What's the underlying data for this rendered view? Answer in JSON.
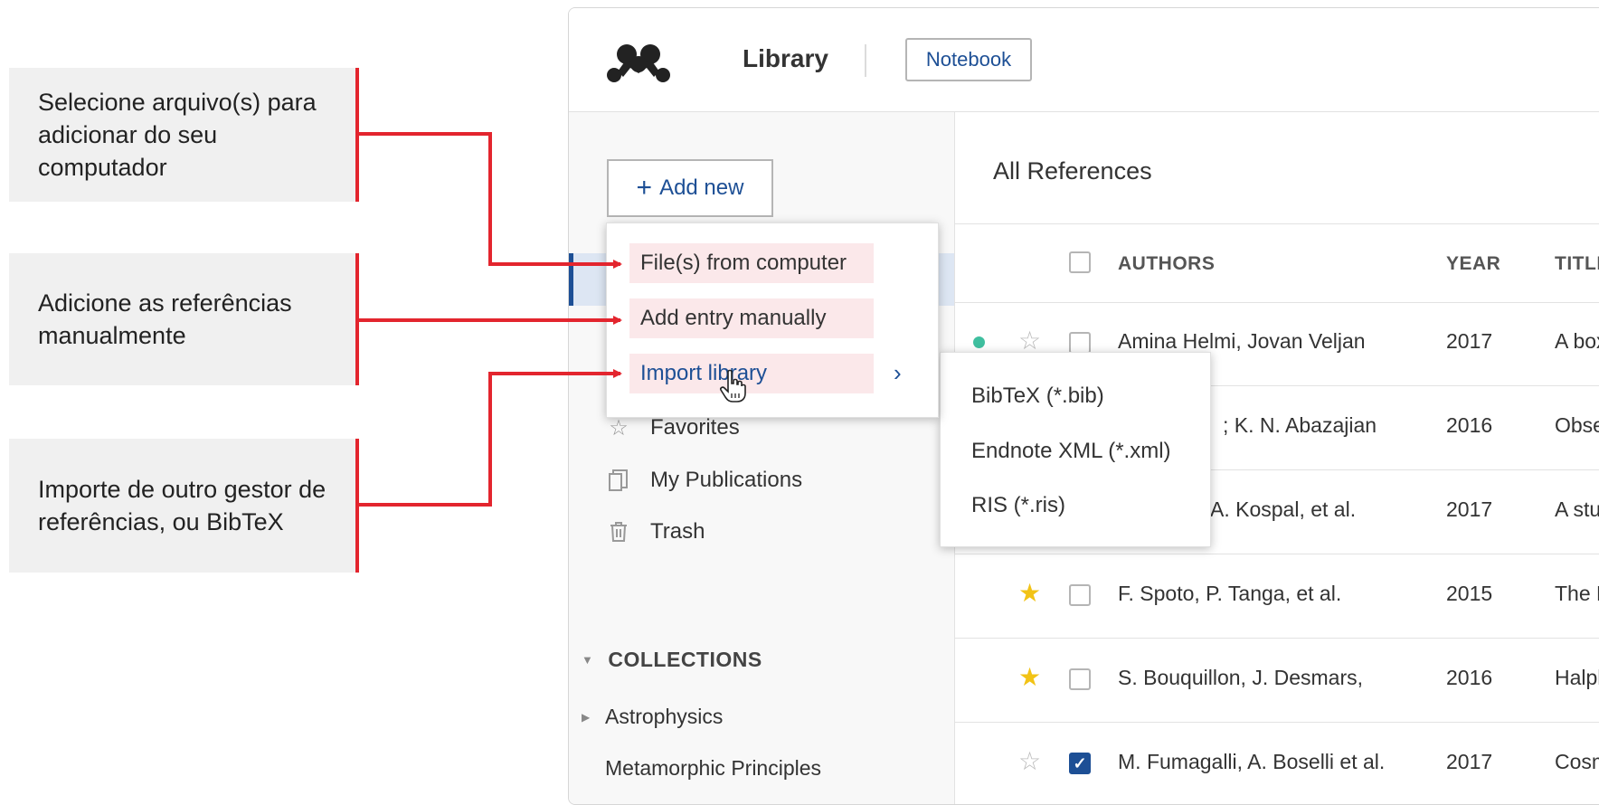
{
  "callouts": [
    {
      "text": "Selecione arquivo(s) para adicionar do seu computador"
    },
    {
      "text": "Adicione as referências manualmente"
    },
    {
      "text": "Importe de outro gestor de referências, ou BibTeX"
    }
  ],
  "colors": {
    "accent": "#1d4f95",
    "callout_red": "#e3252e",
    "highlight": "#fbe8ea",
    "star": "#f2c316",
    "dot": "#3fbf9f"
  },
  "topbar": {
    "title": "Library",
    "notebook_label": "Notebook"
  },
  "sidebar": {
    "add_new_label": "Add new",
    "items": [
      {
        "label": "Favorites",
        "icon": "star-outline-icon"
      },
      {
        "label": "My Publications",
        "icon": "publications-icon"
      },
      {
        "label": "Trash",
        "icon": "trash-icon"
      }
    ],
    "collections_header": "COLLECTIONS",
    "collections": [
      {
        "label": "Astrophysics"
      },
      {
        "label": "Metamorphic Principles"
      }
    ]
  },
  "main": {
    "title": "All References",
    "columns": {
      "authors": "AUTHORS",
      "year": "YEAR",
      "title": "TITLE"
    },
    "rows": [
      {
        "authors": "Amina Helmi, Jovan Veljan",
        "year": "2017",
        "title": "A box",
        "starred": false,
        "checked": false
      },
      {
        "authors": "; K. N. Abazajian",
        "year": "2016",
        "title": "Obse",
        "starred": false,
        "checked": false
      },
      {
        "authors": "A. Kospal, et al.",
        "year": "2017",
        "title": "A stu",
        "starred": false,
        "checked": false
      },
      {
        "authors": "F. Spoto, P. Tanga, et al.",
        "year": "2015",
        "title": "The H",
        "starred": true,
        "checked": false
      },
      {
        "authors": "S. Bouquillon, J. Desmars,",
        "year": "2016",
        "title": "Halph",
        "starred": true,
        "checked": false
      },
      {
        "authors": "M. Fumagalli, A. Boselli et al.",
        "year": "2017",
        "title": "Cosm",
        "starred": false,
        "checked": true
      }
    ]
  },
  "add_menu": {
    "items": [
      {
        "label": "File(s) from computer"
      },
      {
        "label": "Add entry manually"
      },
      {
        "label": "Import library"
      }
    ]
  },
  "import_submenu": {
    "items": [
      {
        "label": "BibTeX (*.bib)"
      },
      {
        "label": "Endnote XML (*.xml)"
      },
      {
        "label": "RIS (*.ris)"
      }
    ]
  }
}
